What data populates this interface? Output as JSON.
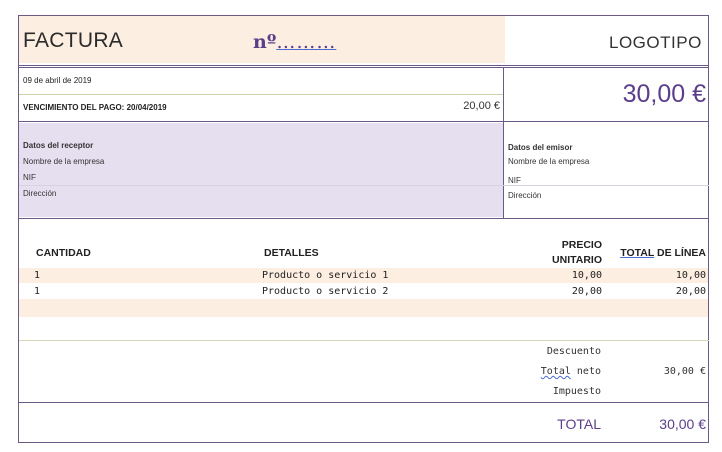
{
  "header": {
    "title": "FACTURA",
    "number_label": "nº",
    "number_dots": "………",
    "logo": "LOGOTIPO"
  },
  "date": "09 de abril de 2019",
  "due": {
    "label": "VENCIMIENTO DEL PAGO: 20/04/2019",
    "amount": "20,00 €"
  },
  "total_display": "30,00 €",
  "receptor": {
    "title": "Datos del receptor",
    "company": "Nombre de la empresa",
    "nif": "NIF",
    "address": "Dirección"
  },
  "emisor": {
    "title": "Datos del emisor",
    "company": "Nombre de la empresa",
    "nif": "NIF",
    "address": "Dirección"
  },
  "table": {
    "headers": {
      "quantity": "CANTIDAD",
      "details": "DETALLES",
      "unit_price_1": "PRECIO",
      "unit_price_2": "UNITARIO",
      "line_total_u": "TOTAL",
      "line_total_rest": " DE LÍNEA"
    },
    "rows": [
      {
        "quantity": "1",
        "details": "Producto o servicio 1",
        "unit_price": "10,00",
        "line_total": "10,00"
      },
      {
        "quantity": "1",
        "details": "Producto o servicio 2",
        "unit_price": "20,00",
        "line_total": "20,00"
      }
    ]
  },
  "totals": {
    "discount_label": "Descuento",
    "net_label_u": "Total",
    "net_label_rest": " neto",
    "net_value": "30,00 €",
    "tax_label": "Impuesto",
    "total_label": "TOTAL",
    "total_value": "30,00 €"
  },
  "colors": {
    "peach": "#fdeee2",
    "lavender": "#e6dff0",
    "accent_purple": "#5b3e8c"
  }
}
